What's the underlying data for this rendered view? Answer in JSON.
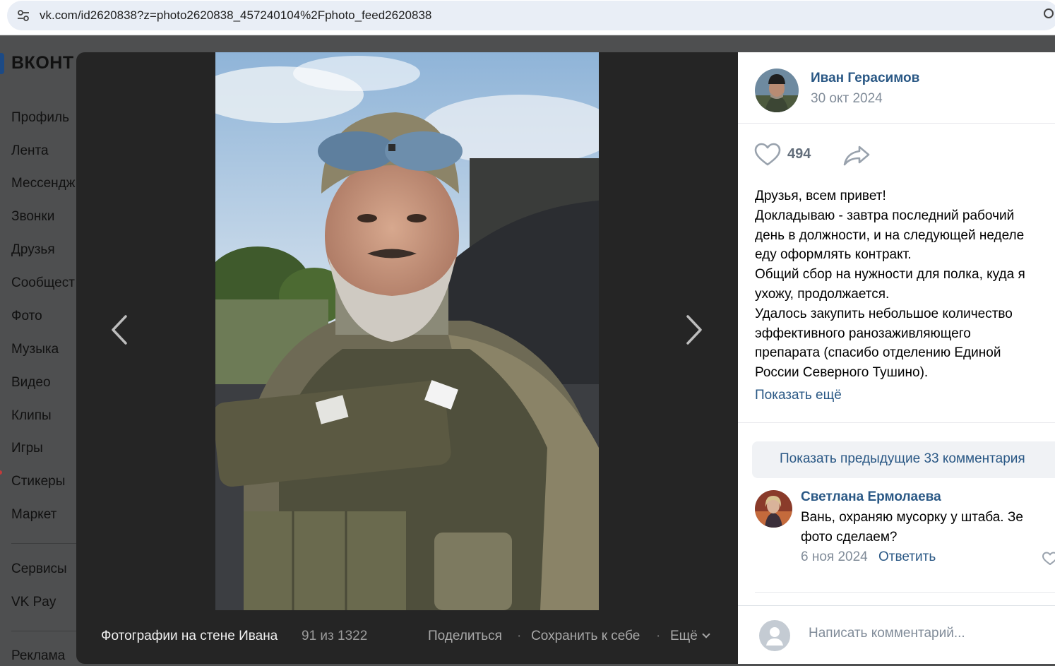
{
  "browser": {
    "url": "vk.com/id2620838?z=photo2620838_457240104%2Fphoto_feed2620838",
    "site_icon": "tune-icon"
  },
  "vk": {
    "logo_text": "ВКОНТ",
    "sidebar": {
      "items": [
        {
          "label": "Профиль"
        },
        {
          "label": "Лента"
        },
        {
          "label": "Мессендж"
        },
        {
          "label": "Звонки"
        },
        {
          "label": "Друзья"
        },
        {
          "label": "Сообщест"
        },
        {
          "label": "Фото"
        },
        {
          "label": "Музыка"
        },
        {
          "label": "Видео"
        },
        {
          "label": "Клипы"
        },
        {
          "label": "Игры"
        },
        {
          "label": "Стикеры"
        },
        {
          "label": "Маркет"
        }
      ],
      "secondary": [
        {
          "label": "Сервисы"
        },
        {
          "label": "VK Pay"
        }
      ],
      "footer": [
        {
          "label": "Реклама"
        }
      ]
    }
  },
  "viewer": {
    "album_title": "Фотографии на стене Ивана",
    "counter": "91 из 1322",
    "actions": {
      "share": "Поделиться",
      "save": "Сохранить к себе",
      "more": "Ещё",
      "separator": "·"
    }
  },
  "post": {
    "author": "Иван Герасимов",
    "date": "30 окт 2024",
    "likes": "494",
    "text_lines": [
      "Друзья, всем привет!",
      "Докладываю - завтра последний рабочий",
      "день в должности, и на следующей неделе",
      "еду оформлять контракт.",
      "Общий сбор на нужности для полка, куда я",
      "ухожу, продолжается.",
      "Удалось закупить небольшое количество",
      "эффективного ранозаживляющего",
      "препарата (спасибо отделению Единой",
      "России Северного Тушино)."
    ],
    "show_more": "Показать ещё"
  },
  "comments": {
    "show_previous": "Показать предыдущие 33 комментария",
    "items": [
      {
        "author": "Светлана Ермолаева",
        "text_lines": [
          "Вань, охраняю мусорку у штаба. Зе",
          "фото сделаем?"
        ],
        "date": "6 ноя 2024",
        "reply": "Ответить"
      }
    ],
    "input_placeholder": "Написать комментарий..."
  },
  "colors": {
    "link": "#2a5885",
    "muted": "#818c99",
    "viewer_bg": "#252525",
    "page_dim": "#4e4f50"
  }
}
